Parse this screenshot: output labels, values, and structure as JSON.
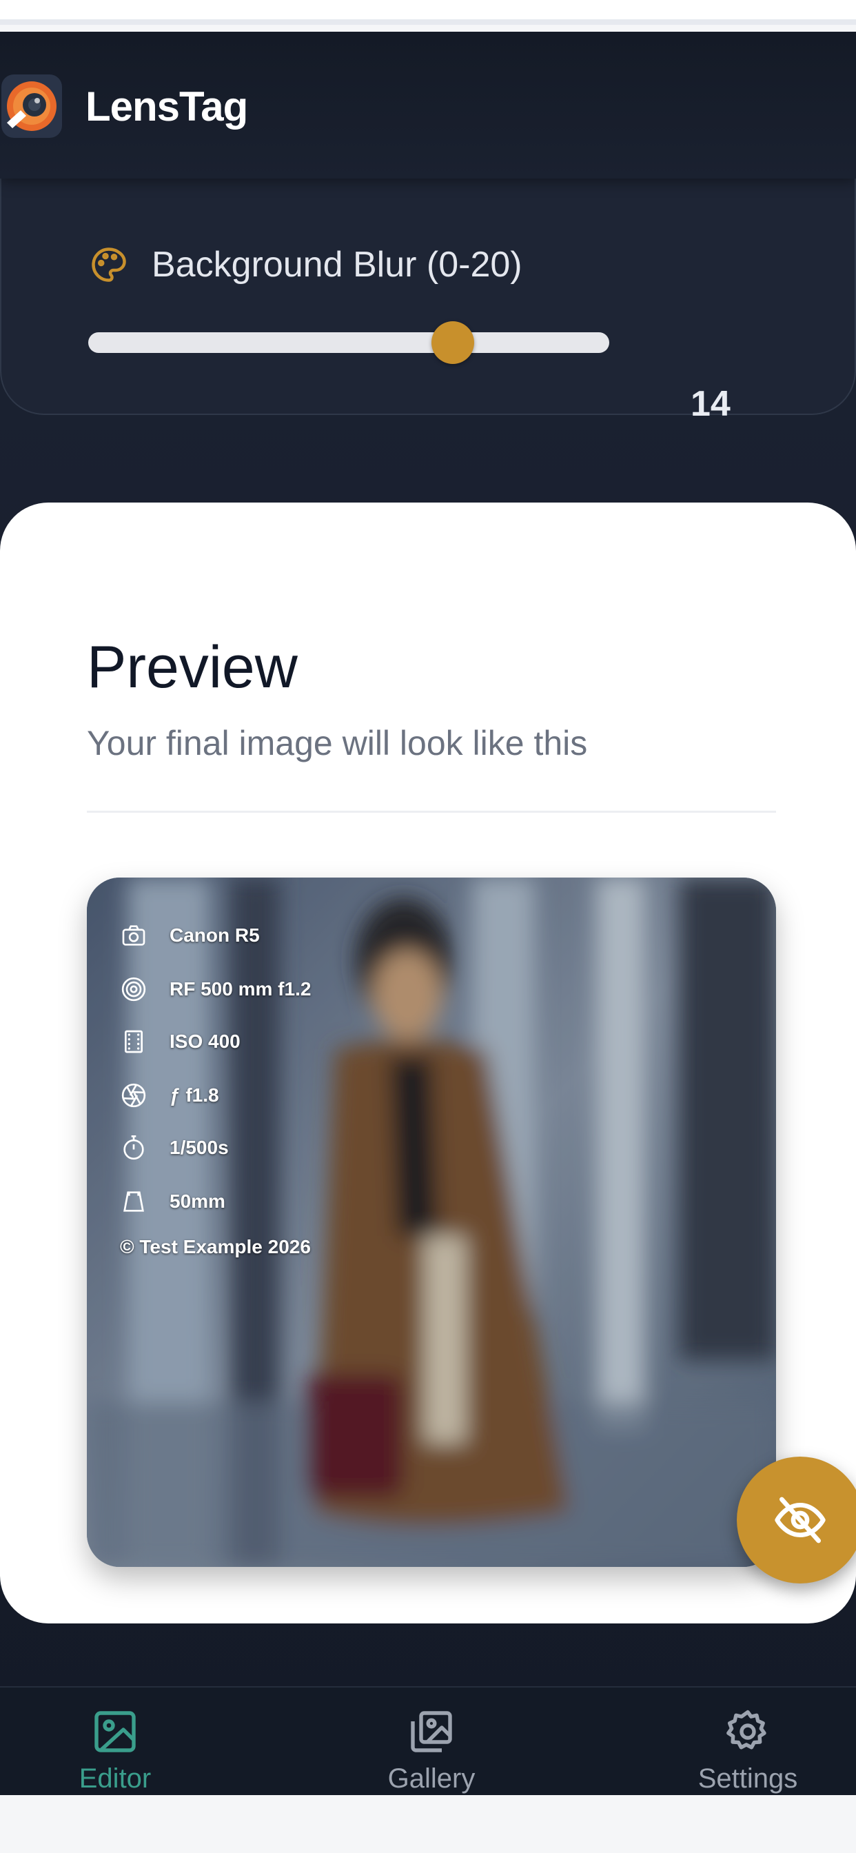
{
  "app": {
    "name": "LensTag"
  },
  "controls": {
    "blur": {
      "label": "Background Blur (0-20)",
      "value": "14",
      "min": 0,
      "max": 20,
      "level": 14
    }
  },
  "preview": {
    "title": "Preview",
    "subtitle": "Your final image will look like this",
    "overlay": [
      {
        "icon": "camera-icon",
        "text": "Canon R5"
      },
      {
        "icon": "lens-icon",
        "text": "RF 500 mm f1.2"
      },
      {
        "icon": "film-icon",
        "text": "ISO 400"
      },
      {
        "icon": "aperture-icon",
        "text": "ƒ f1.8"
      },
      {
        "icon": "timer-icon",
        "text": "1/500s"
      },
      {
        "icon": "focal-length-icon",
        "text": "50mm"
      }
    ],
    "copyright": "© Test Example 2026",
    "toggle_icon": "eye-off-icon"
  },
  "tabs": [
    {
      "label": "Editor",
      "icon": "image-icon",
      "active": true
    },
    {
      "label": "Gallery",
      "icon": "gallery-icon",
      "active": false
    },
    {
      "label": "Settings",
      "icon": "gear-icon",
      "active": false
    }
  ],
  "colors": {
    "accent": "#c8902c",
    "active_tab": "#3a9e8c",
    "inactive_tab": "#9ca3af",
    "dark_bg": "#1c2333"
  }
}
